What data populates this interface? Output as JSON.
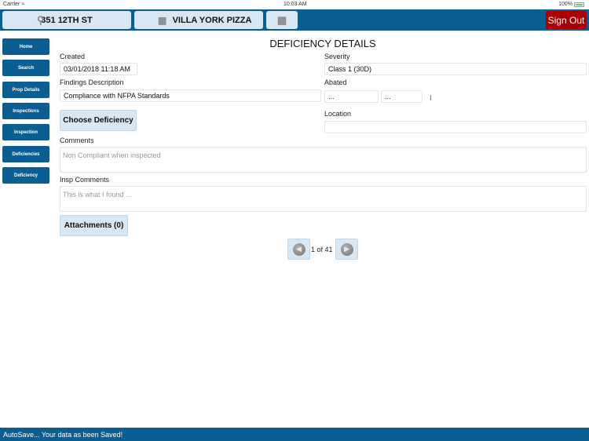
{
  "status_bar": {
    "carrier": "Carrier",
    "time": "10:03 AM",
    "battery": "100%"
  },
  "topbar": {
    "address_label": "351 12TH ST",
    "business_label": "VILLA YORK PIZZA",
    "sign_out_label": "Sign Out"
  },
  "sidebar": {
    "items": [
      {
        "label": "Home"
      },
      {
        "label": "Search"
      },
      {
        "label": "Prop Details"
      },
      {
        "label": "Inspections"
      },
      {
        "label": "Inspection"
      },
      {
        "label": "Deficiencies"
      },
      {
        "label": "Deficiency"
      }
    ]
  },
  "main": {
    "title": "DEFICIENCY DETAILS",
    "created_label": "Created",
    "created_value": "03/01/2018 11:18 AM",
    "findings_label": "Findings Description",
    "findings_value": "Compliance with NFPA Standards",
    "severity_label": "Severity",
    "severity_value": "Class 1 (30D)",
    "abated_label": "Abated",
    "abated_date": "...",
    "abated_time": "...",
    "choose_deficiency_label": "Choose Deficiency",
    "location_label": "Location",
    "location_value": "",
    "comments_label": "Comments",
    "comments_placeholder": "Non Compliant when inspected",
    "insp_comments_label": "Insp Comments",
    "insp_comments_placeholder": "This is what I found ...",
    "attachments_label": "Attachments (0)",
    "pager_text": "1 of 41"
  },
  "footer": {
    "message": "AutoSave... Your data as been Saved!"
  }
}
